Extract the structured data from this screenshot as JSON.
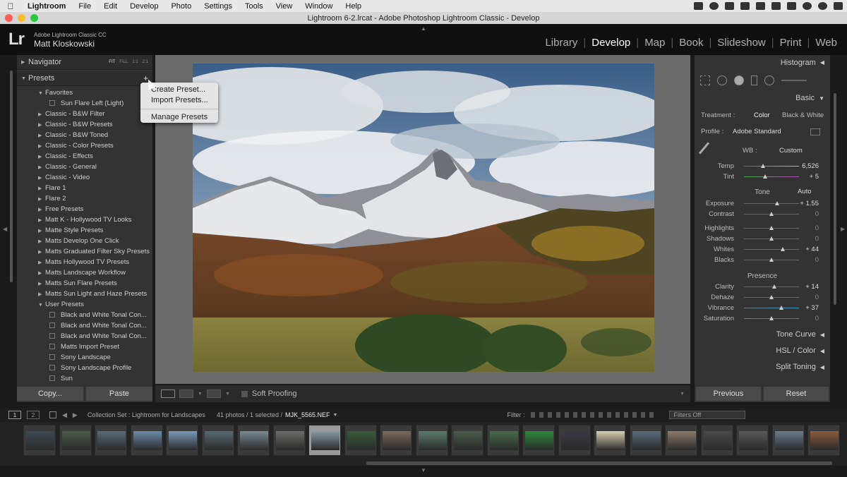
{
  "mac_menu": {
    "items": [
      "Lightroom",
      "File",
      "Edit",
      "Develop",
      "Photo",
      "Settings",
      "Tools",
      "View",
      "Window",
      "Help"
    ]
  },
  "window": {
    "title": "Lightroom 6-2.lrcat - Adobe Photoshop Lightroom Classic - Develop"
  },
  "identity": {
    "logo": "Lr",
    "product": "Adobe Lightroom Classic CC",
    "user": "Matt Kloskowski"
  },
  "modules": [
    "Library",
    "Develop",
    "Map",
    "Book",
    "Slideshow",
    "Print",
    "Web"
  ],
  "left": {
    "navigator": "Navigator",
    "nav_options": [
      "FIT",
      "FILL",
      "1:1",
      "2:1"
    ],
    "presets_title": "Presets",
    "rows": [
      {
        "type": "folder-open",
        "label": "Favorites"
      },
      {
        "type": "item",
        "label": "Sun Flare Left (Light)"
      },
      {
        "type": "folder",
        "label": "Classic - B&W Filter"
      },
      {
        "type": "folder",
        "label": "Classic - B&W Presets"
      },
      {
        "type": "folder",
        "label": "Classic - B&W Toned"
      },
      {
        "type": "folder",
        "label": "Classic - Color Presets"
      },
      {
        "type": "folder",
        "label": "Classic - Effects"
      },
      {
        "type": "folder",
        "label": "Classic - General"
      },
      {
        "type": "folder",
        "label": "Classic - Video"
      },
      {
        "type": "folder",
        "label": "Flare 1"
      },
      {
        "type": "folder",
        "label": "Flare 2"
      },
      {
        "type": "folder",
        "label": "Free Presets"
      },
      {
        "type": "folder",
        "label": "Matt K - Hollywood TV Looks"
      },
      {
        "type": "folder",
        "label": "Matte Style Presets"
      },
      {
        "type": "folder",
        "label": "Matts Develop One Click"
      },
      {
        "type": "folder",
        "label": "Matts Graduated Filter Sky Presets"
      },
      {
        "type": "folder",
        "label": "Matts Hollywood TV Presets"
      },
      {
        "type": "folder",
        "label": "Matts Landscape Workflow"
      },
      {
        "type": "folder",
        "label": "Matts Sun Flare Presets"
      },
      {
        "type": "folder",
        "label": "Matts Sun Light and Haze Presets"
      },
      {
        "type": "folder-open",
        "label": "User Presets"
      },
      {
        "type": "item",
        "label": "Black and White Tonal Con..."
      },
      {
        "type": "item",
        "label": "Black and White Tonal Con..."
      },
      {
        "type": "item",
        "label": "Black and White Tonal Con..."
      },
      {
        "type": "item",
        "label": "Matts Import Preset"
      },
      {
        "type": "item",
        "label": "Sony Landscape"
      },
      {
        "type": "item",
        "label": "Sony Landscape Profile"
      },
      {
        "type": "item",
        "label": "Sun"
      }
    ],
    "copy": "Copy...",
    "paste": "Paste"
  },
  "dropdown": {
    "items": [
      "Create Preset...",
      "Import Presets...",
      "Manage Presets"
    ]
  },
  "toolbar": {
    "soft_proofing": "Soft Proofing"
  },
  "right": {
    "histogram": "Histogram",
    "basic": "Basic",
    "treatment_label": "Treatment :",
    "treatment_color": "Color",
    "treatment_bw": "Black & White",
    "profile_label": "Profile :",
    "profile_value": "Adobe Standard",
    "wb_label": "WB :",
    "wb_value": "Custom",
    "temp": {
      "label": "Temp",
      "value": "6,526",
      "pos": 0.35
    },
    "tint": {
      "label": "Tint",
      "value": "+ 5",
      "pos": 0.38
    },
    "tone": "Tone",
    "auto": "Auto",
    "tone_rows": [
      {
        "label": "Exposure",
        "value": "+ 1.55",
        "pos": 0.6
      },
      {
        "label": "Contrast",
        "value": "0",
        "pos": 0.5
      },
      {
        "label": "Highlights",
        "value": "0",
        "pos": 0.5
      },
      {
        "label": "Shadows",
        "value": "0",
        "pos": 0.5
      },
      {
        "label": "Whites",
        "value": "+ 44",
        "pos": 0.7
      },
      {
        "label": "Blacks",
        "value": "0",
        "pos": 0.5
      }
    ],
    "presence": "Presence",
    "presence_rows": [
      {
        "label": "Clarity",
        "value": "+ 14",
        "pos": 0.55
      },
      {
        "label": "Dehaze",
        "value": "0",
        "pos": 0.5
      },
      {
        "label": "Vibrance",
        "value": "+ 37",
        "pos": 0.68
      },
      {
        "label": "Saturation",
        "value": "0",
        "pos": 0.5
      }
    ],
    "tone_curve": "Tone Curve",
    "hsl": "HSL / Color",
    "split": "Split Toning",
    "previous": "Previous",
    "reset": "Reset"
  },
  "filmbar": {
    "page1": "1",
    "page2": "2",
    "collection": "Collection Set : Lightroom for Landscapes",
    "count": "41 photos / 1 selected /",
    "filename": "MJK_5565.NEF",
    "filter": "Filter :",
    "filters_off": "Filters Off"
  },
  "colors": {
    "accent_green": "#2fb44a",
    "accent_cyan": "#2bb3d6"
  }
}
